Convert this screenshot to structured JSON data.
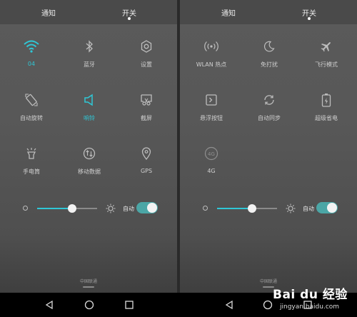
{
  "accent": "#2fc7d6",
  "panels": [
    {
      "header": {
        "tab_notifications": "通知",
        "tab_switches": "开关"
      },
      "tiles": [
        {
          "label": "04",
          "icon": "wifi-icon",
          "active": true
        },
        {
          "label": "蓝牙",
          "icon": "bluetooth-icon",
          "active": false
        },
        {
          "label": "设置",
          "icon": "gear-icon",
          "active": false
        },
        {
          "label": "自动旋转",
          "icon": "rotate-icon",
          "active": false
        },
        {
          "label": "响铃",
          "icon": "speaker-icon",
          "active": true
        },
        {
          "label": "截屏",
          "icon": "screenshot-icon",
          "active": false
        },
        {
          "label": "手电筒",
          "icon": "flashlight-icon",
          "active": false
        },
        {
          "label": "移动数据",
          "icon": "mobile-data-icon",
          "active": false
        },
        {
          "label": "GPS",
          "icon": "location-icon",
          "active": false
        }
      ],
      "brightness": {
        "level": 0.58,
        "auto_label": "自动",
        "auto_on": true
      },
      "carrier": "中国联通"
    },
    {
      "header": {
        "tab_notifications": "通知",
        "tab_switches": "开关"
      },
      "tiles": [
        {
          "label": "WLAN 热点",
          "icon": "hotspot-icon",
          "active": false
        },
        {
          "label": "免打扰",
          "icon": "moon-icon",
          "active": false
        },
        {
          "label": "飞行模式",
          "icon": "airplane-icon",
          "active": false
        },
        {
          "label": "悬浮按钮",
          "icon": "floating-button-icon",
          "active": false
        },
        {
          "label": "自动同步",
          "icon": "sync-icon",
          "active": false
        },
        {
          "label": "超级省电",
          "icon": "battery-saver-icon",
          "active": false
        },
        {
          "label": "4G",
          "icon": "4g-icon",
          "active": false
        }
      ],
      "brightness": {
        "level": 0.58,
        "auto_label": "自动",
        "auto_on": true
      },
      "carrier": "中国联通"
    }
  ],
  "navbar": {
    "icons": [
      "back-icon",
      "home-icon",
      "recents-icon"
    ]
  },
  "watermark": {
    "main": "Bai du 经验",
    "url": "jingyan.baidu.com"
  }
}
